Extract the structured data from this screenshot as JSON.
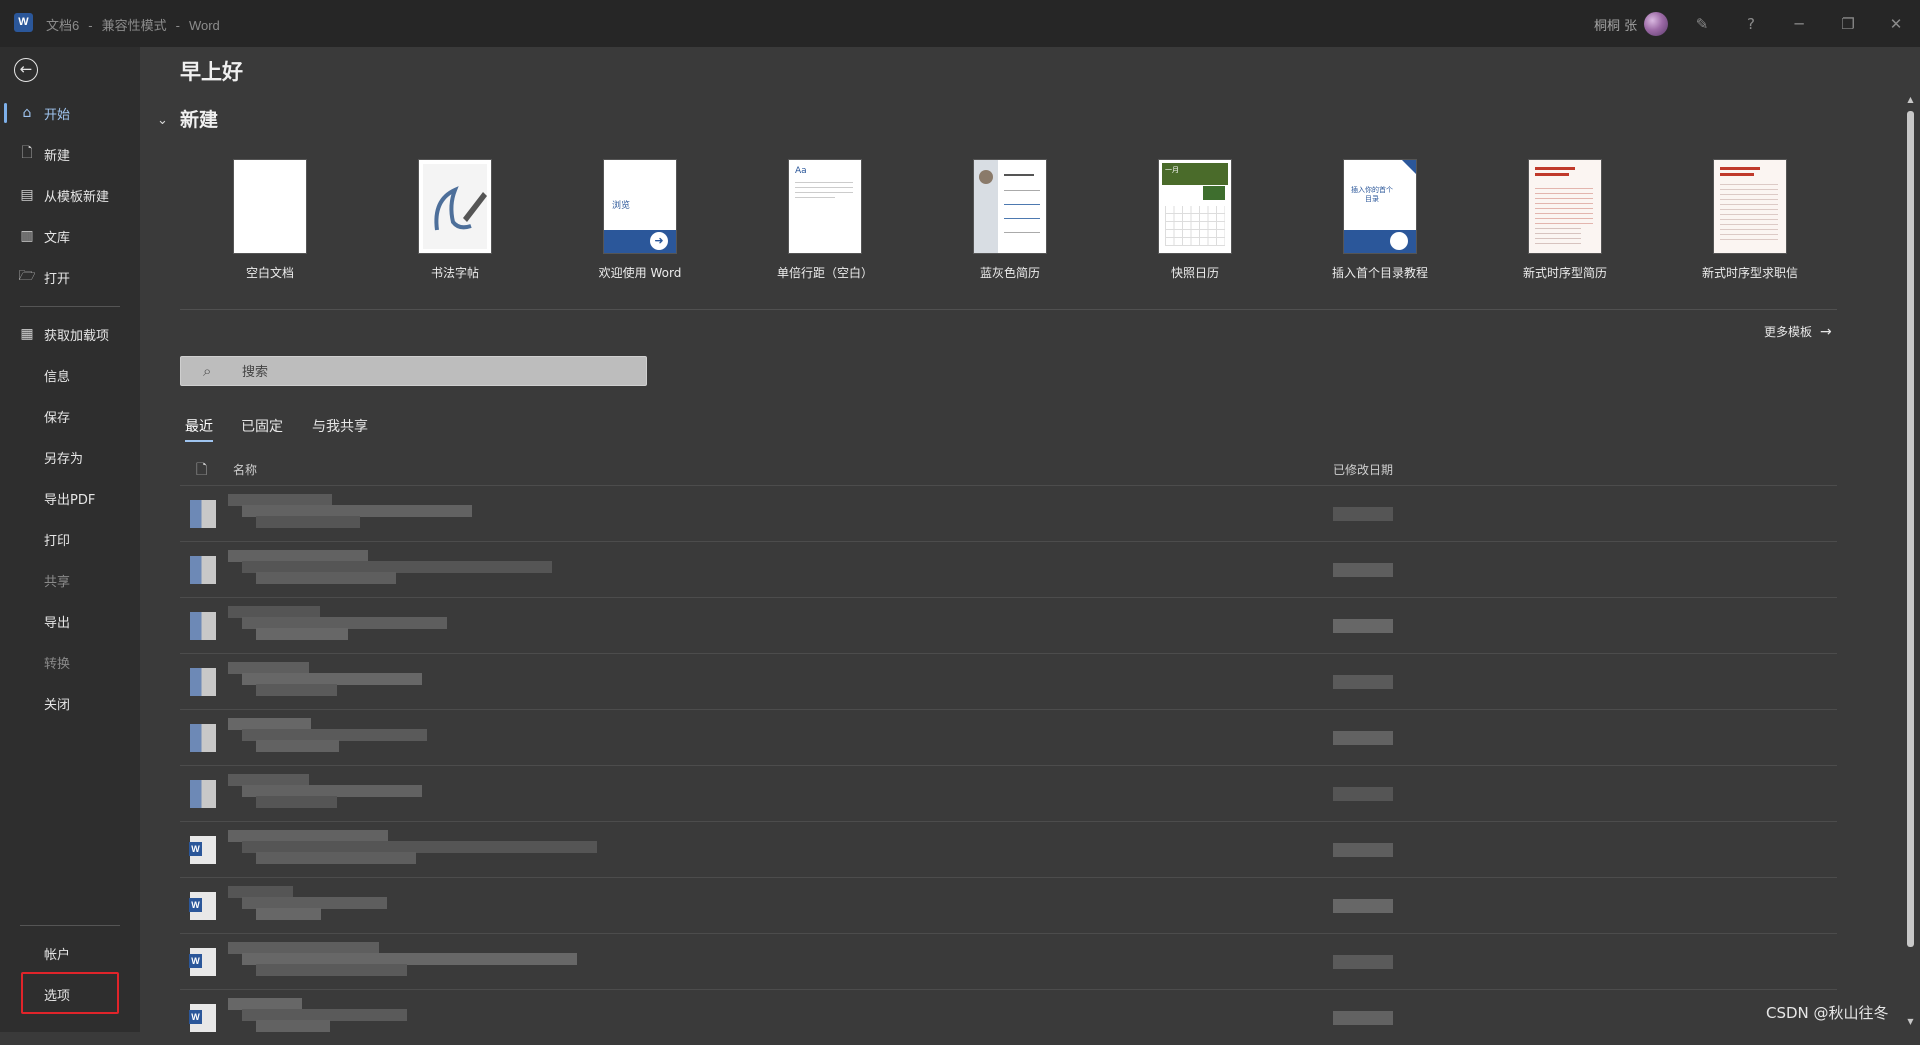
{
  "titlebar": {
    "app_icon": "W",
    "doc_name": "文档6",
    "mode": "兼容性模式",
    "app_name": "Word",
    "separator": "-",
    "user_name": "桐桐 张",
    "icons": [
      "feedback-icon",
      "help-icon",
      "minimize-icon",
      "restore-icon",
      "close-icon"
    ],
    "help_glyph": "?",
    "minimize_glyph": "─",
    "restore_glyph": "❐",
    "close_glyph": "✕",
    "feedback_glyph": "✎"
  },
  "sidebar": {
    "back_glyph": "←",
    "primary": [
      {
        "label": "开始",
        "icon": "home-icon",
        "glyph": "⌂"
      },
      {
        "label": "新建",
        "icon": "new-document-icon",
        "glyph": "🗋"
      },
      {
        "label": "从模板新建",
        "icon": "template-icon",
        "glyph": "▤"
      },
      {
        "label": "文库",
        "icon": "library-icon",
        "glyph": "▥"
      },
      {
        "label": "打开",
        "icon": "folder-open-icon",
        "glyph": "🗁"
      },
      {
        "label": "获取加载项",
        "icon": "addins-icon",
        "glyph": "▦"
      }
    ],
    "secondary": [
      "信息",
      "保存",
      "另存为",
      "导出PDF",
      "打印",
      "共享",
      "导出",
      "转换",
      "关闭"
    ],
    "bottom": [
      "帐户",
      "选项"
    ]
  },
  "main": {
    "greeting": "早上好",
    "section_toggle": "⌄",
    "section_title": "新建",
    "templates": [
      {
        "label": "空白文档"
      },
      {
        "label": "书法字帖"
      },
      {
        "label": "欢迎使用 Word",
        "thumb_text": "浏览"
      },
      {
        "label": "单倍行距（空白）",
        "thumb_text": "Aa"
      },
      {
        "label": "蓝灰色简历"
      },
      {
        "label": "快照日历",
        "thumb_text": "一月"
      },
      {
        "label": "插入首个目录教程",
        "thumb_text": "插入你的首个目录"
      },
      {
        "label": "新式时序型简历"
      },
      {
        "label": "新式时序型求职信"
      }
    ],
    "more_templates": "更多模板",
    "more_arrow": "→",
    "search_placeholder": "搜索",
    "tabs": [
      "最近",
      "已固定",
      "与我共享"
    ],
    "columns": {
      "name": "名称",
      "modified": "已修改日期"
    },
    "accent_color": "#9fc4ef"
  },
  "watermark": "CSDN @秋山往冬"
}
